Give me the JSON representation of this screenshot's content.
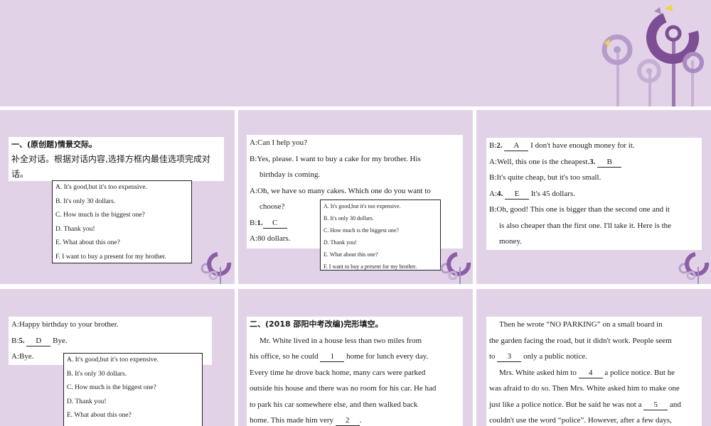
{
  "dialogue": {
    "heading": "一、(原创题)情景交际。",
    "instruction": "补全对话。根据对话内容,选择方框内最佳选项完成对话。",
    "options": [
      "A. It's good,but it's too expensive.",
      "B. It's only 30 dollars.",
      "C. How much is the biggest one?",
      "D. Thank you!",
      "E. What about this one?",
      "F. I want to buy a present for my brother."
    ],
    "s2_lines": [
      {
        "text": "A:Can I help you?",
        "indent": false
      },
      {
        "text": "B:Yes, please. I want to buy a cake for my brother. His",
        "indent": false
      },
      {
        "text": "birthday is coming.",
        "indent": true
      },
      {
        "text": "A:Oh, we have so many cakes. Which one do you want to",
        "indent": false
      },
      {
        "text": "choose?",
        "indent": true
      }
    ],
    "s2_b1": {
      "pre": "B:",
      "num": "1.",
      "answer": "C"
    },
    "s2_last": "A:80 dollars.",
    "s3_line1": {
      "pre": "B:",
      "num": "2.",
      "answer": "A",
      "post": "I don't have enough money for it."
    },
    "s3_line2": {
      "pre": "A:Well, this one is the cheapest.",
      "num": "3.",
      "answer": "B"
    },
    "s3_line3": "B:It's quite cheap, but it's too small.",
    "s3_line4": {
      "pre": "A:",
      "num": "4.",
      "answer": "E",
      "post": "It's 45 dollars."
    },
    "s3_rest": [
      {
        "text": "B:Oh, good! This one is bigger than the second one and it",
        "indent": false
      },
      {
        "text": "is also cheaper than the first one. I'll take it. Here is the",
        "indent": true
      },
      {
        "text": "money.",
        "indent": true
      }
    ],
    "s4_line1": "A:Happy birthday to your brother.",
    "s4_line2": {
      "pre": "B:",
      "num": "5.",
      "answer": "D",
      "post": "Bye."
    },
    "s4_line3": "A:Bye."
  },
  "cloze": {
    "heading": "二、(2018 邵阳中考改编)完形填空。",
    "p1": [
      {
        "text": "Mr. White lived in a house less than two miles from",
        "indent": true
      },
      {
        "text": "his office, so he could",
        "blank": "1",
        "after": "home for lunch every day."
      },
      {
        "text": "Every time he drove back home, many cars were parked"
      },
      {
        "text": "outside his house and there was no room for his car. He had"
      },
      {
        "text": "to park his car somewhere else, and then walked back"
      },
      {
        "text": "home. This made him very",
        "blank": "2",
        "after": "."
      }
    ],
    "p2": [
      {
        "text": "Then he wrote “NO PARKING” on a small board in",
        "indent": true
      },
      {
        "text": "the garden facing the road, but it didn't work. People seem"
      },
      {
        "text": "to",
        "blank": "3",
        "after": "only a public notice."
      },
      {
        "text": "Mrs. White asked him to",
        "blank": "4",
        "after": "a police notice. But he",
        "indent": true
      },
      {
        "text": "was afraid to do so. Then Mrs. White asked him to make one"
      },
      {
        "text": "just like a police notice. But he said he was not a",
        "blank": "5",
        "after": "and"
      },
      {
        "text": "couldn't use the word “police”. However, after a few days,"
      }
    ]
  },
  "colors": {
    "slide_bg": "#e1d2e8",
    "purple_dark": "#7d4e93",
    "purple_mid": "#a98bc0",
    "purple_light": "#cbb7d8",
    "yellow": "#f2d34a"
  }
}
